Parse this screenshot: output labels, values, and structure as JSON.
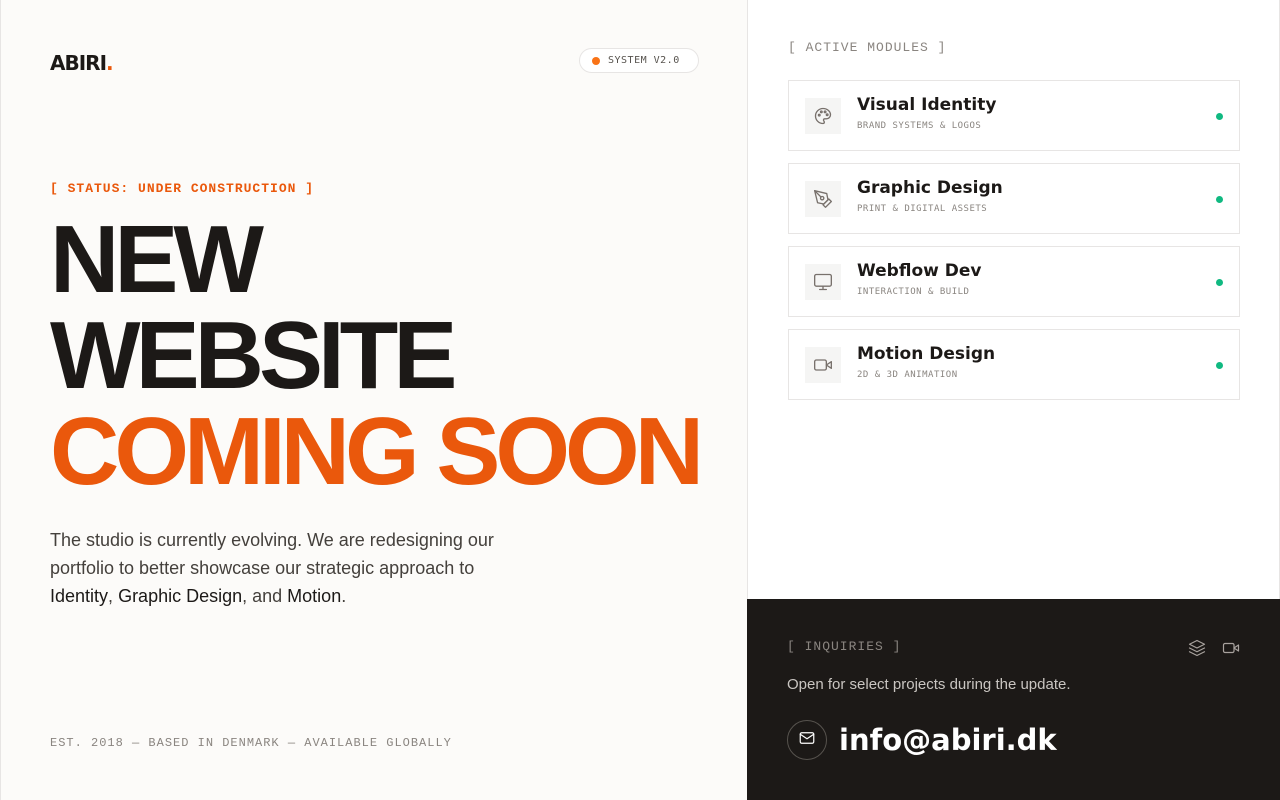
{
  "brand": {
    "name": "ABIRI",
    "dot": "."
  },
  "badge": {
    "label": "SYSTEM V2.0"
  },
  "status": "[ STATUS: UNDER CONSTRUCTION ]",
  "headline": {
    "line1": "NEW",
    "line2": "WEBSITE",
    "line3": "COMING SOON"
  },
  "description": {
    "part1": "The studio is currently evolving. We are redesigning our portfolio to better showcase our strategic approach to ",
    "hl1": "Identity",
    "sep1": ", ",
    "hl2": "Graphic Design",
    "sep2": ", and ",
    "hl3": "Motion",
    "end": "."
  },
  "footer": "EST. 2018 — BASED IN DENMARK — AVAILABLE GLOBALLY",
  "modules": {
    "title": "[ ACTIVE MODULES ]",
    "items": [
      {
        "name": "Visual Identity",
        "sub": "BRAND SYSTEMS & LOGOS",
        "icon": "palette-icon"
      },
      {
        "name": "Graphic Design",
        "sub": "PRINT & DIGITAL ASSETS",
        "icon": "pen-tool-icon"
      },
      {
        "name": "Webflow Dev",
        "sub": "INTERACTION & BUILD",
        "icon": "monitor-icon"
      },
      {
        "name": "Motion Design",
        "sub": "2D & 3D ANIMATION",
        "icon": "video-icon"
      }
    ]
  },
  "inquiries": {
    "title": "[ INQUIRIES ]",
    "text": "Open for select projects during the update.",
    "email": "info@abiri.dk"
  },
  "colors": {
    "accent": "#ea580c",
    "dark": "#1c1917",
    "status_on": "#10b981"
  }
}
